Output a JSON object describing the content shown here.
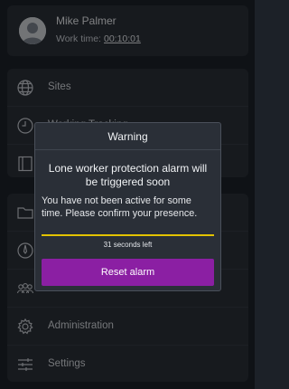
{
  "profile": {
    "name": "Mike Palmer",
    "worktime_label": "Work time:",
    "worktime_value": "00:10:01",
    "avatar_icon": "user-avatar-icon"
  },
  "menu_top": [
    {
      "label": "Sites",
      "icon": "globe-icon"
    },
    {
      "label": "Working Tracking",
      "icon": "clock-icon"
    },
    {
      "label": "",
      "icon": "book-icon"
    }
  ],
  "menu_bottom": [
    {
      "label": "",
      "icon": "folder-icon"
    },
    {
      "label": "",
      "icon": "compass-icon"
    },
    {
      "label": "",
      "icon": "users-icon"
    },
    {
      "label": "Administration",
      "icon": "gear-icon"
    },
    {
      "label": "Settings",
      "icon": "sliders-icon"
    }
  ],
  "dialog": {
    "title": "Warning",
    "headline": "Lone worker protection alarm will be triggered soon",
    "body": "You have not been active for some time. Please confirm your presence.",
    "progress": 1.0,
    "countdown": "31 seconds left",
    "button_label": "Reset alarm"
  },
  "colors": {
    "background": "#1c2128",
    "card": "#2b3038",
    "accent_button": "#8b1fa3",
    "progress": "#e2c300"
  }
}
